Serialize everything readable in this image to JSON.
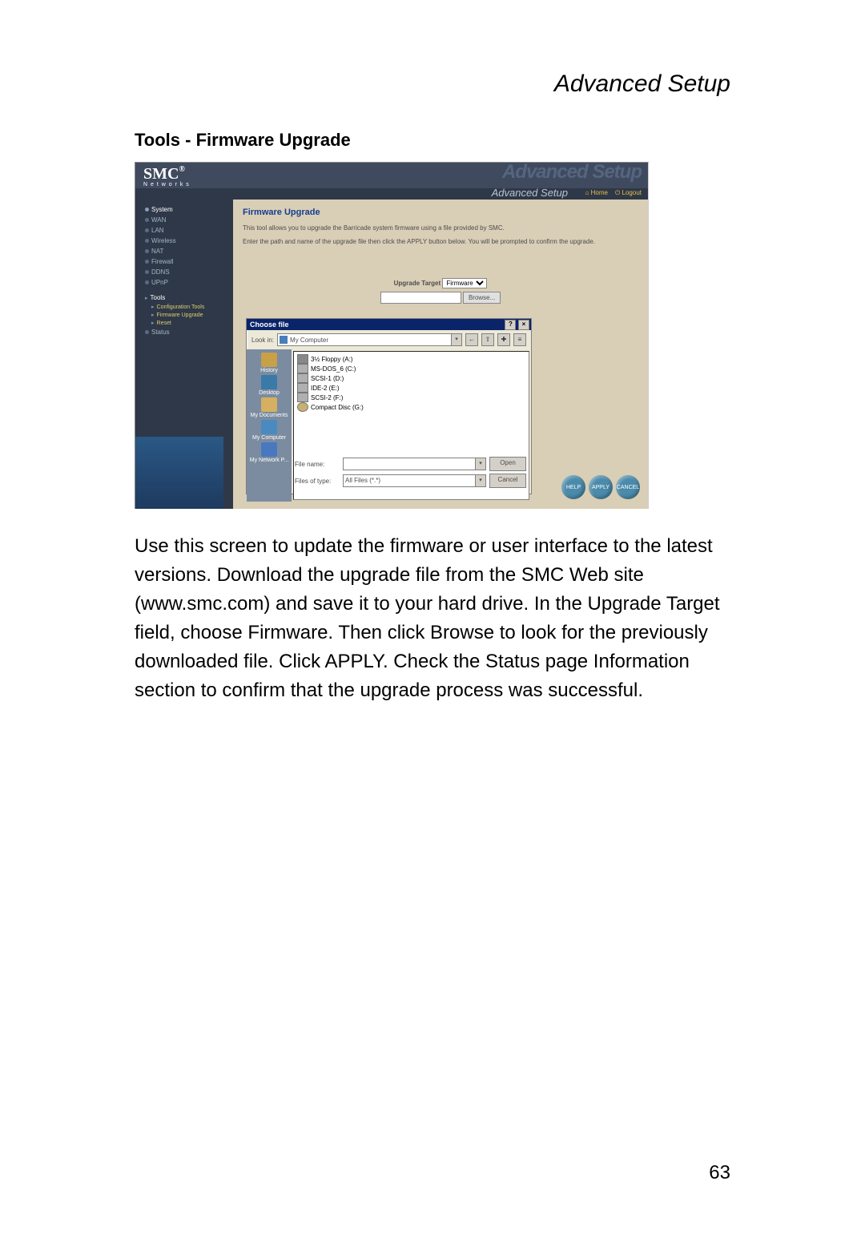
{
  "doc": {
    "header": "Advanced Setup",
    "section_title": "Tools - Firmware Upgrade",
    "body_text": "Use this screen to update the firmware or user interface to the latest versions. Download the upgrade file from the SMC Web site (www.smc.com) and save it to your hard drive. In the Upgrade Target field, choose Firmware. Then click Browse to look for the previously downloaded file. Click APPLY. Check the Status page Information section to confirm that the upgrade process was successful.",
    "page_number": "63"
  },
  "router": {
    "brand": "SMC",
    "brand_mark": "®",
    "brand_sub": "N e t w o r k s",
    "ghost_text": "Advanced Setup",
    "sub_title": "Advanced Setup",
    "home_label": "Home",
    "logout_label": "Logout",
    "sidebar": {
      "items": [
        {
          "label": "System",
          "active": true
        },
        {
          "label": "WAN"
        },
        {
          "label": "LAN"
        },
        {
          "label": "Wireless"
        },
        {
          "label": "NAT"
        },
        {
          "label": "Firewall"
        },
        {
          "label": "DDNS"
        },
        {
          "label": "UPnP"
        }
      ],
      "tools_label": "Tools",
      "tools_sub": [
        {
          "label": "Configuration Tools"
        },
        {
          "label": "Firmware Upgrade"
        },
        {
          "label": "Reset"
        }
      ],
      "status_label": "Status"
    },
    "main": {
      "title": "Firmware Upgrade",
      "p1": "This tool allows you to upgrade the Barricade system firmware using a file provided by SMC.",
      "p2": "Enter the path and name of the upgrade file then click the APPLY button below. You will be prompted to confirm the upgrade.",
      "target_label": "Upgrade Target",
      "target_value": "Firmware",
      "browse_label": "Browse...",
      "buttons": {
        "help": "HELP",
        "apply": "APPLY",
        "cancel": "CANCEL"
      }
    }
  },
  "dialog": {
    "title": "Choose file",
    "help_btn": "?",
    "close_btn": "×",
    "lookin_label": "Look in:",
    "lookin_value": "My Computer",
    "toolbar_icons": [
      "←",
      "⇧",
      "✚",
      "≡"
    ],
    "places": [
      {
        "name": "History",
        "color": "#c8a048"
      },
      {
        "name": "Desktop",
        "color": "#3a7aa8"
      },
      {
        "name": "My Documents",
        "color": "#d4b060"
      },
      {
        "name": "My Computer",
        "color": "#4a8ac0"
      },
      {
        "name": "My Network P...",
        "color": "#4a78c0"
      }
    ],
    "drives": [
      {
        "label": "3½ Floppy (A:)",
        "type": "floppy"
      },
      {
        "label": "MS-DOS_6 (C:)",
        "type": "hdd"
      },
      {
        "label": "SCSI-1 (D:)",
        "type": "hdd"
      },
      {
        "label": "IDE-2 (E:)",
        "type": "hdd"
      },
      {
        "label": "SCSI-2 (F:)",
        "type": "hdd"
      },
      {
        "label": "Compact Disc (G:)",
        "type": "cd"
      }
    ],
    "filename_label": "File name:",
    "filename_value": "",
    "filetype_label": "Files of type:",
    "filetype_value": "All Files (*.*)",
    "open_label": "Open",
    "cancel_label": "Cancel"
  }
}
